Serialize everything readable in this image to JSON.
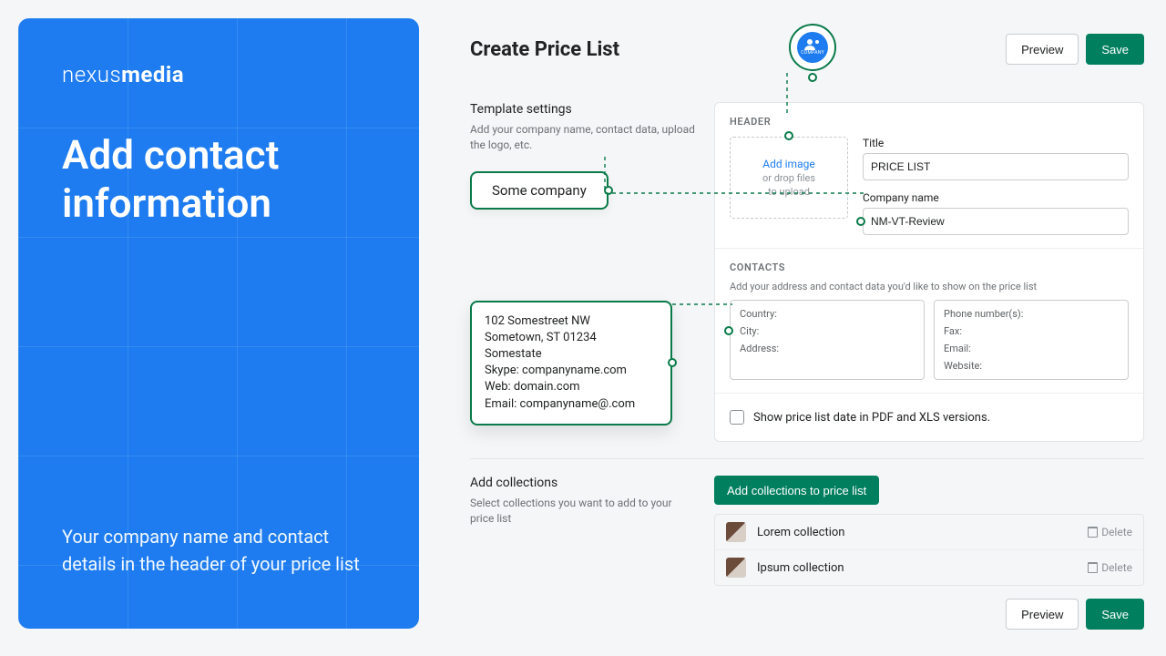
{
  "promo": {
    "brand_light": "nexus",
    "brand_bold": "media",
    "headline": "Add contact information",
    "sub": "Your company name and contact details in the header of your price list"
  },
  "header": {
    "title": "Create Price List",
    "logo_caption": "COMPANY",
    "preview": "Preview",
    "save": "Save"
  },
  "template": {
    "title": "Template settings",
    "help": "Add your company name, contact data, upload the logo, etc.",
    "chip": "Some company",
    "contact_lines": {
      "l1": "102 Somestreet NW",
      "l2": "Sometown, ST 01234",
      "l3": "Somestate",
      "l4": "Skype: companyname.com",
      "l5": "Web: domain.com",
      "l6": "Email: companyname@.com"
    }
  },
  "card": {
    "header_label": "HEADER",
    "add_image": "Add image",
    "drop_hint1": "or drop files",
    "drop_hint2": "to upload",
    "title_label": "Title",
    "title_value": "PRICE LIST",
    "company_label": "Company name",
    "company_value": "NM-VT-Review",
    "contacts_label": "CONTACTS",
    "contacts_help": "Add your address and contact data you'd like to show on the price list",
    "left_box": {
      "a": "Country:",
      "b": "City:",
      "c": "Address:"
    },
    "right_box": {
      "a": "Phone number(s):",
      "b": "Fax:",
      "c": "Email:",
      "d": "Website:"
    },
    "show_date": "Show price list date in PDF and XLS versions."
  },
  "collections": {
    "title": "Add collections",
    "help": "Select collections you want to add to your price list",
    "add_btn": "Add collections to price list",
    "rows": {
      "r1": "Lorem collection",
      "r2": "Ipsum collection"
    },
    "delete": "Delete"
  },
  "footer": {
    "preview": "Preview",
    "save": "Save"
  }
}
